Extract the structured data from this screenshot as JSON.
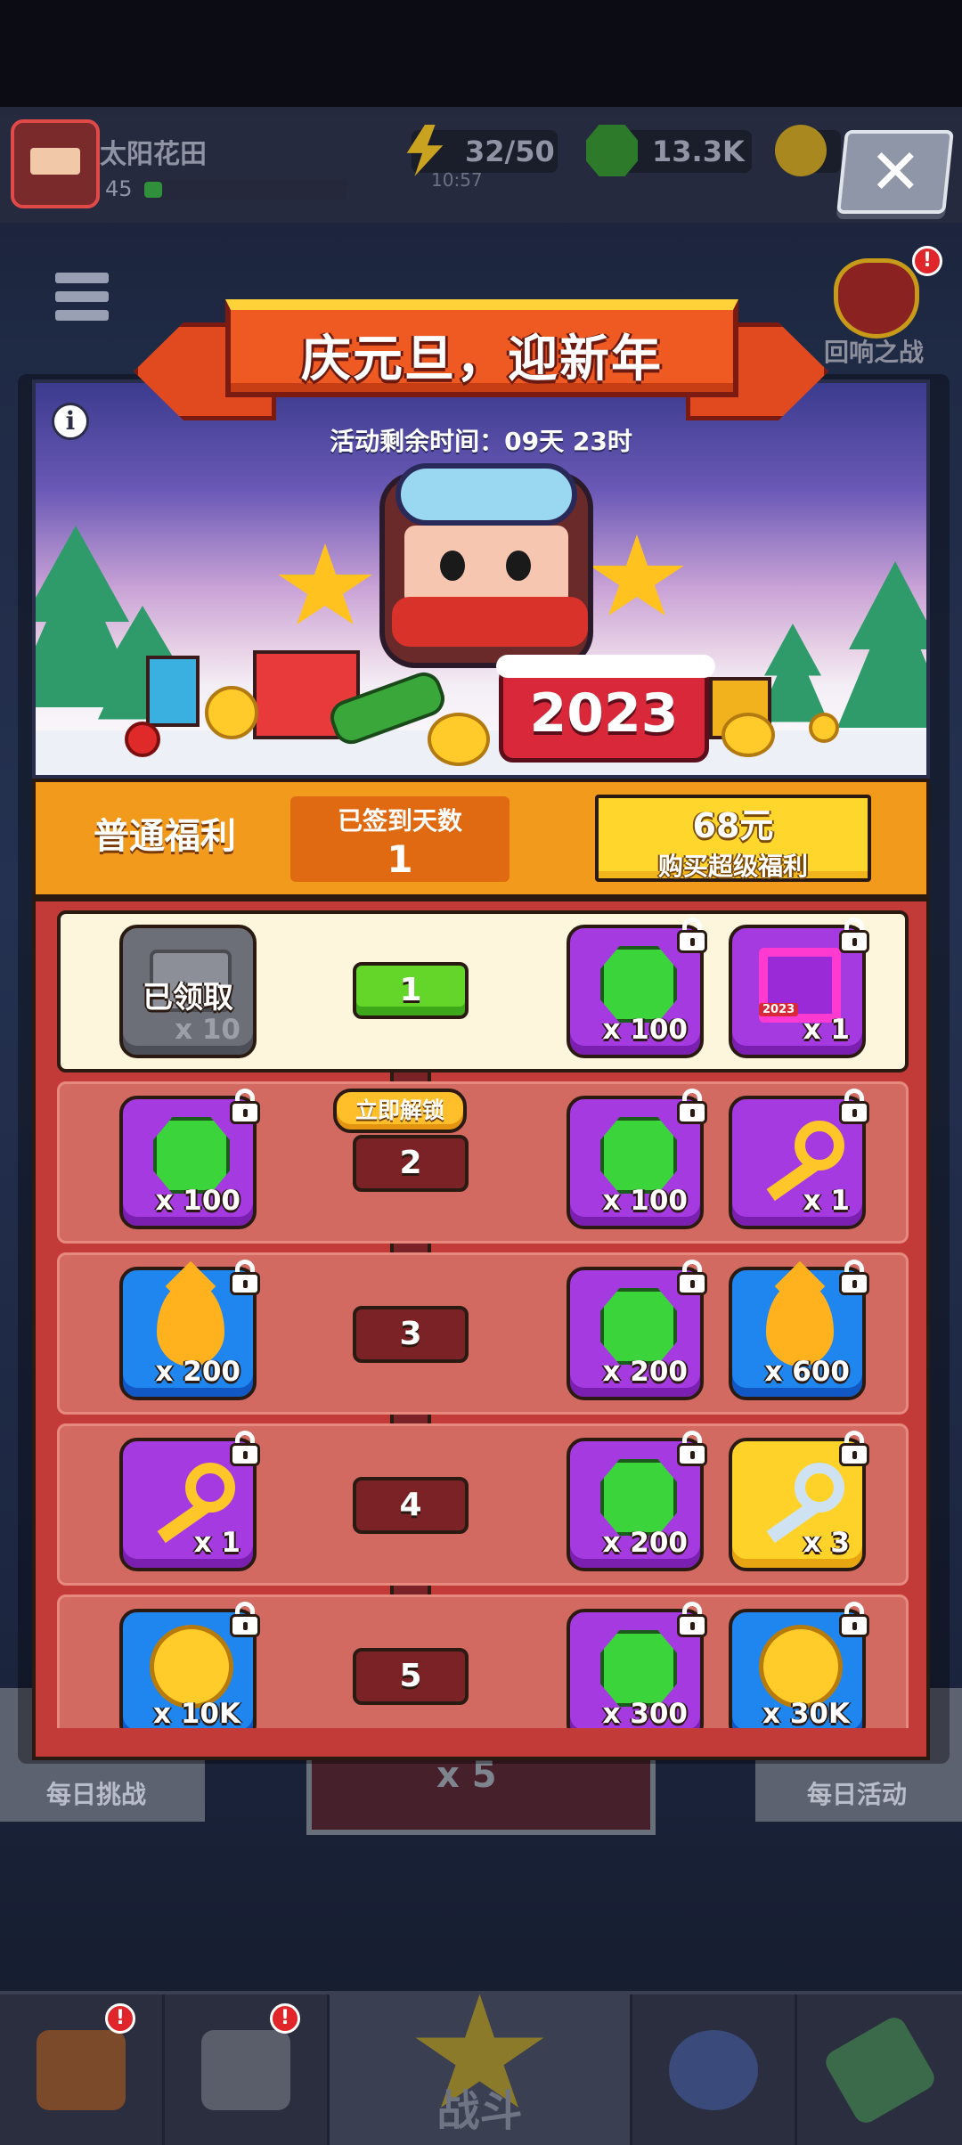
{
  "topbar": {
    "player_name": "太阳花田",
    "player_level": "45",
    "energy": "32/50",
    "energy_timer": "10:57",
    "gems": "13.3K",
    "close_symbol": "✕"
  },
  "background": {
    "echo_battle_label": "回响之战",
    "notif_symbol": "!",
    "daily_challenge_label": "每日挑战",
    "daily_event_label": "每日活动",
    "energy_cost": "x 5",
    "battle_label": "战斗"
  },
  "popup": {
    "title": "庆元旦，迎新年",
    "info_symbol": "i",
    "timer_text": "活动剩余时间：09天 23时",
    "hero_sign": "2023",
    "tabs": {
      "normal_label": "普通福利",
      "days_label": "已签到天数",
      "days_value": "1",
      "super_price": "68元",
      "super_label": "购买超级福利"
    },
    "unlock_button": "立即解锁",
    "frame_tag": "2023",
    "rows": [
      {
        "day": "1",
        "claimed_label": "已领取",
        "free": {
          "icon": "scroll-icon",
          "qty": "x 10",
          "color": "grey"
        },
        "super": [
          {
            "icon": "gem-icon",
            "qty": "x 100",
            "color": "purple"
          },
          {
            "icon": "frame-icon",
            "qty": "x 1",
            "color": "purple"
          }
        ]
      },
      {
        "day": "2",
        "free": {
          "icon": "gem-icon",
          "qty": "x 100",
          "color": "purple"
        },
        "super": [
          {
            "icon": "gem-icon",
            "qty": "x 100",
            "color": "purple"
          },
          {
            "icon": "gold-key-icon",
            "qty": "x 1",
            "color": "purple"
          }
        ]
      },
      {
        "day": "3",
        "free": {
          "icon": "fuel-drop-icon",
          "qty": "x 200",
          "color": "blue"
        },
        "super": [
          {
            "icon": "gem-icon",
            "qty": "x 200",
            "color": "purple"
          },
          {
            "icon": "fuel-drop-icon",
            "qty": "x 600",
            "color": "blue"
          }
        ]
      },
      {
        "day": "4",
        "free": {
          "icon": "gold-key-icon",
          "qty": "x 1",
          "color": "purple"
        },
        "super": [
          {
            "icon": "gem-icon",
            "qty": "x 200",
            "color": "purple"
          },
          {
            "icon": "silver-key-icon",
            "qty": "x 3",
            "color": "gold"
          }
        ]
      },
      {
        "day": "5",
        "free": {
          "icon": "coin-icon",
          "qty": "x 10K",
          "color": "blue"
        },
        "super": [
          {
            "icon": "gem-icon",
            "qty": "x 300",
            "color": "purple"
          },
          {
            "icon": "coin-icon",
            "qty": "x 30K",
            "color": "blue"
          }
        ]
      }
    ]
  }
}
